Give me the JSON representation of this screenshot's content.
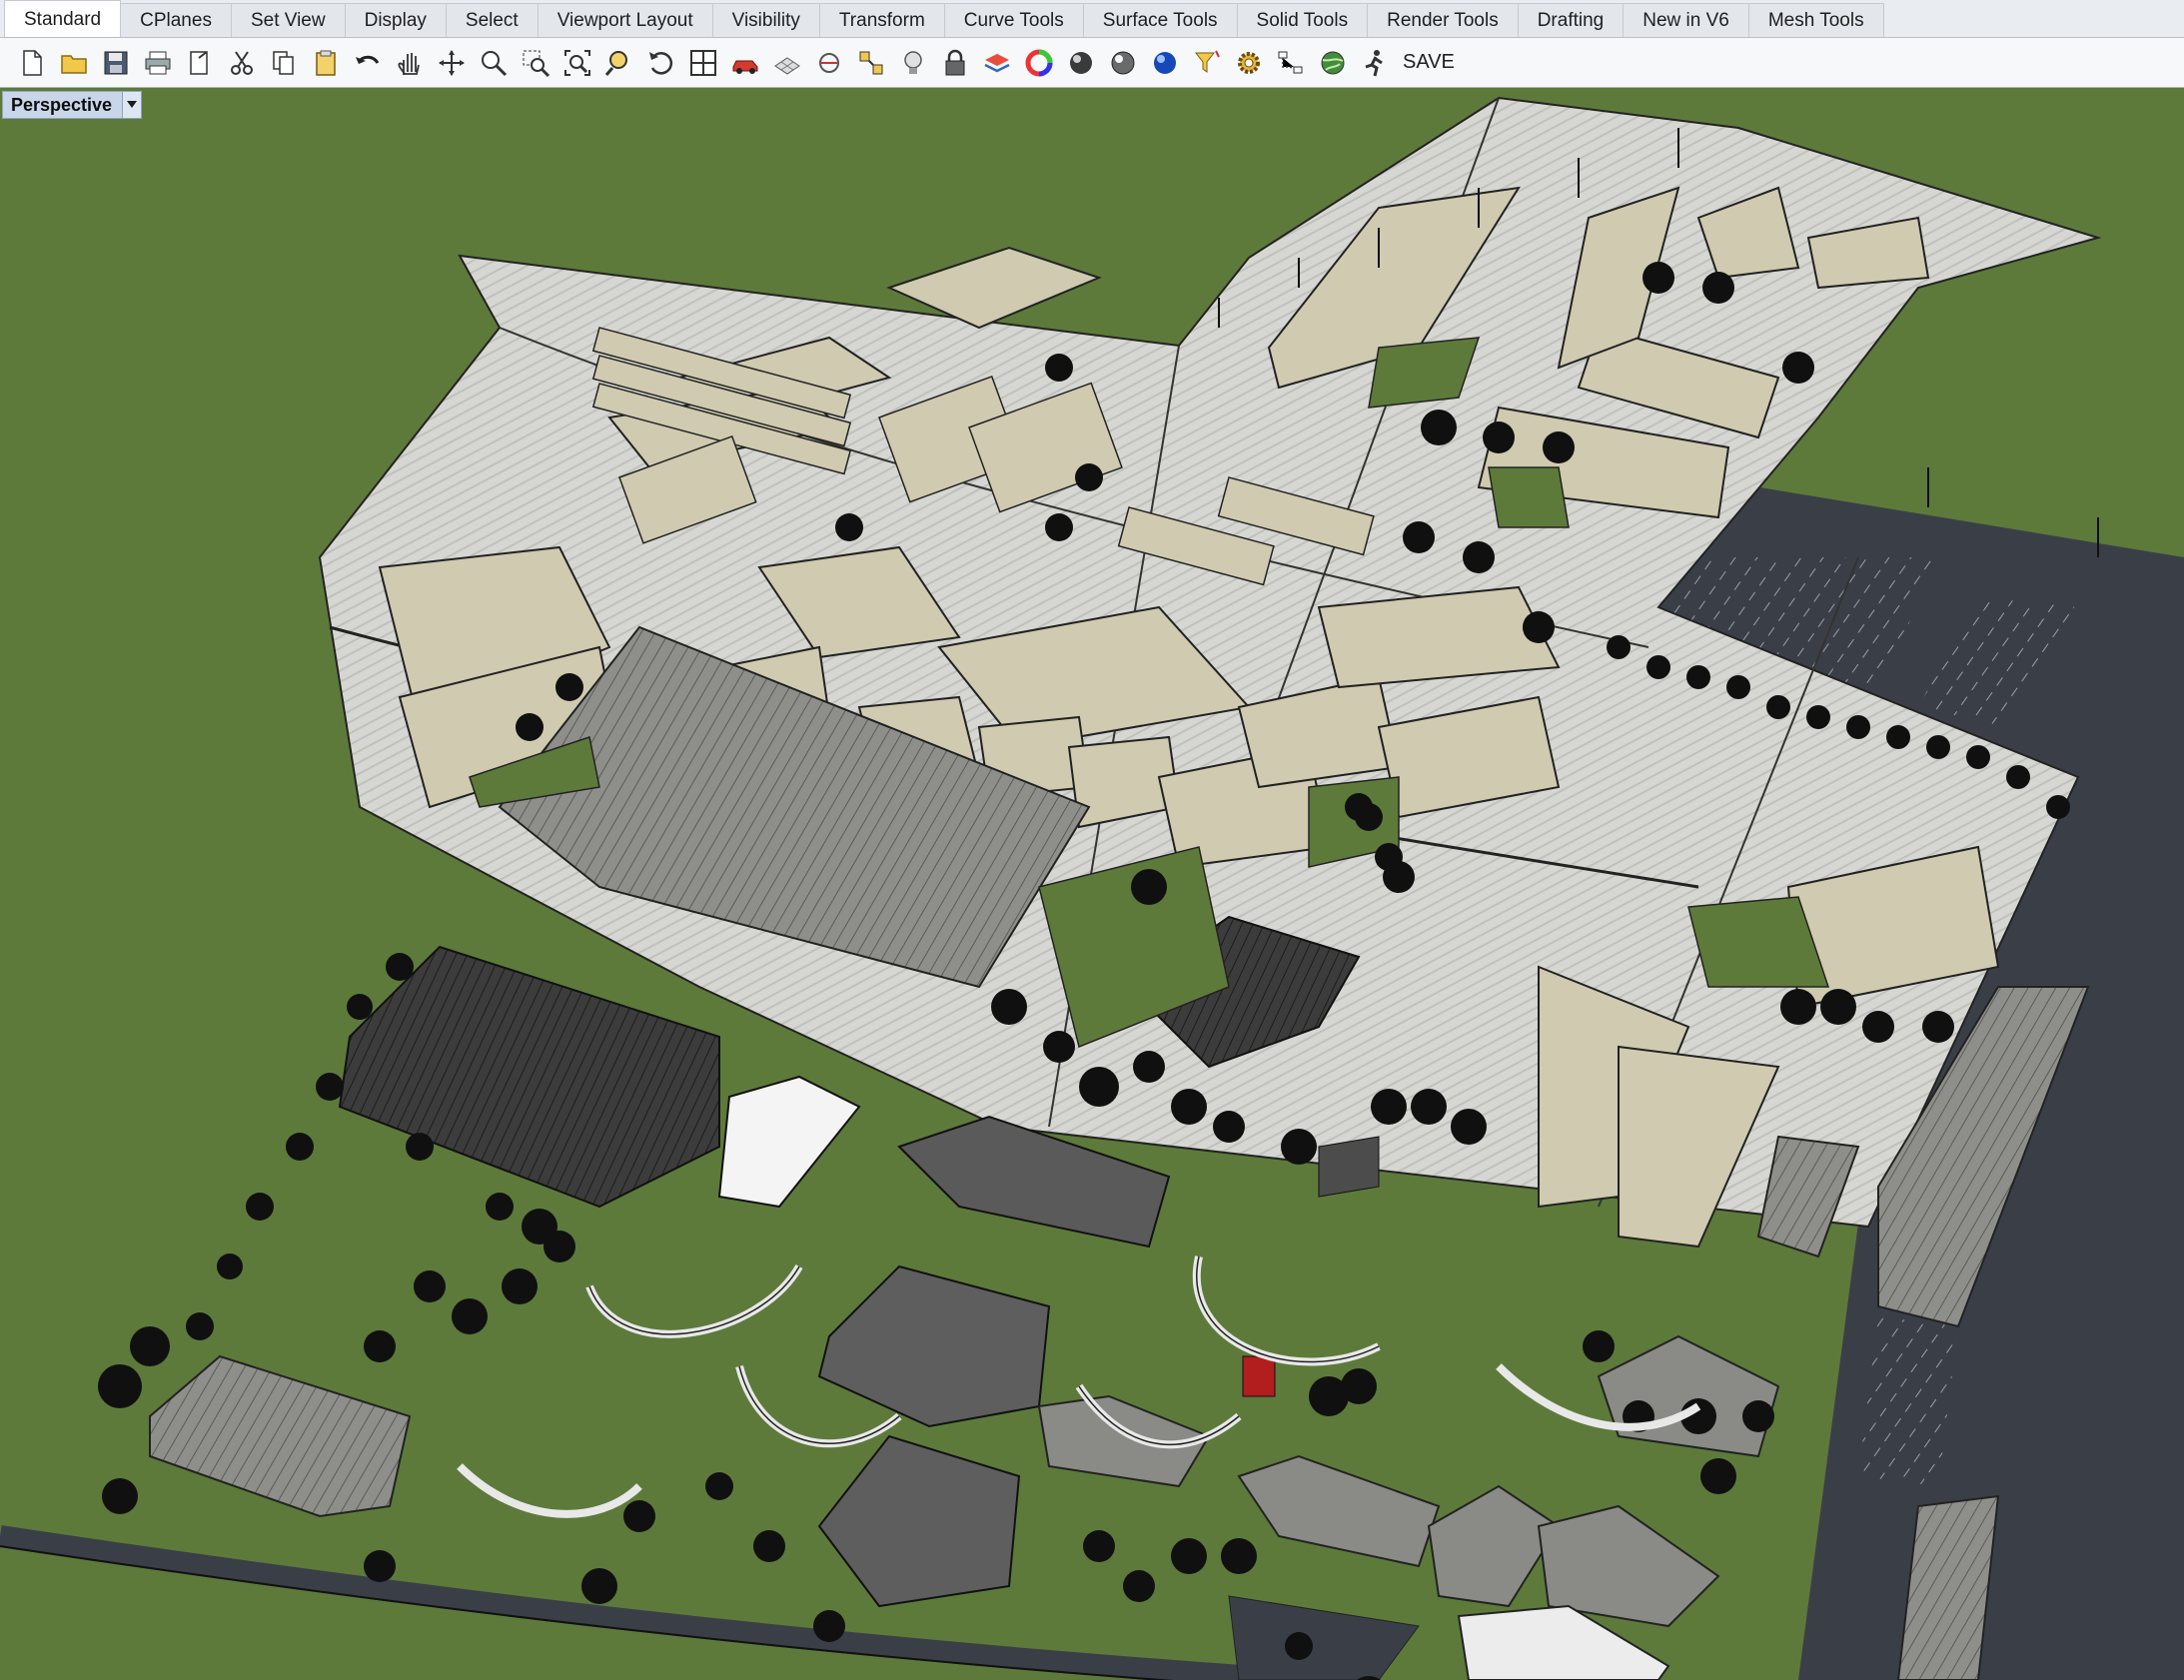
{
  "menu_tabs": [
    "Standard",
    "CPlanes",
    "Set View",
    "Display",
    "Select",
    "Viewport Layout",
    "Visibility",
    "Transform",
    "Curve Tools",
    "Surface Tools",
    "Solid Tools",
    "Render Tools",
    "Drafting",
    "New in V6",
    "Mesh Tools"
  ],
  "active_tab": "Standard",
  "toolbar": {
    "icons": [
      "new-file-icon",
      "open-folder-icon",
      "save-icon",
      "print-icon",
      "import-icon",
      "cut-icon",
      "copy-icon",
      "paste-icon",
      "undo-icon",
      "pan-hand-icon",
      "rotate-view-icon",
      "zoom-icon",
      "zoom-window-icon",
      "zoom-extents-icon",
      "zoom-selected-icon",
      "undo-view-icon",
      "viewport-layout-icon",
      "car-icon",
      "grid-icon",
      "cplane-icon",
      "snap-icon",
      "light-icon",
      "lock-icon",
      "layer-icon",
      "color-wheel-icon",
      "shaded-sphere-icon",
      "rendered-sphere-icon",
      "material-sphere-icon",
      "filter-icon",
      "options-gear-icon",
      "named-views-icon",
      "globe-icon",
      "running-man-icon"
    ],
    "save_label": "SAVE"
  },
  "viewport": {
    "label": "Perspective"
  },
  "colors": {
    "grass": "#5d7a3a",
    "pavement": "#d7d7d3",
    "asphalt": "#3a3f47",
    "building": "#cdc9b0",
    "dark_building": "#4d4d4d"
  }
}
